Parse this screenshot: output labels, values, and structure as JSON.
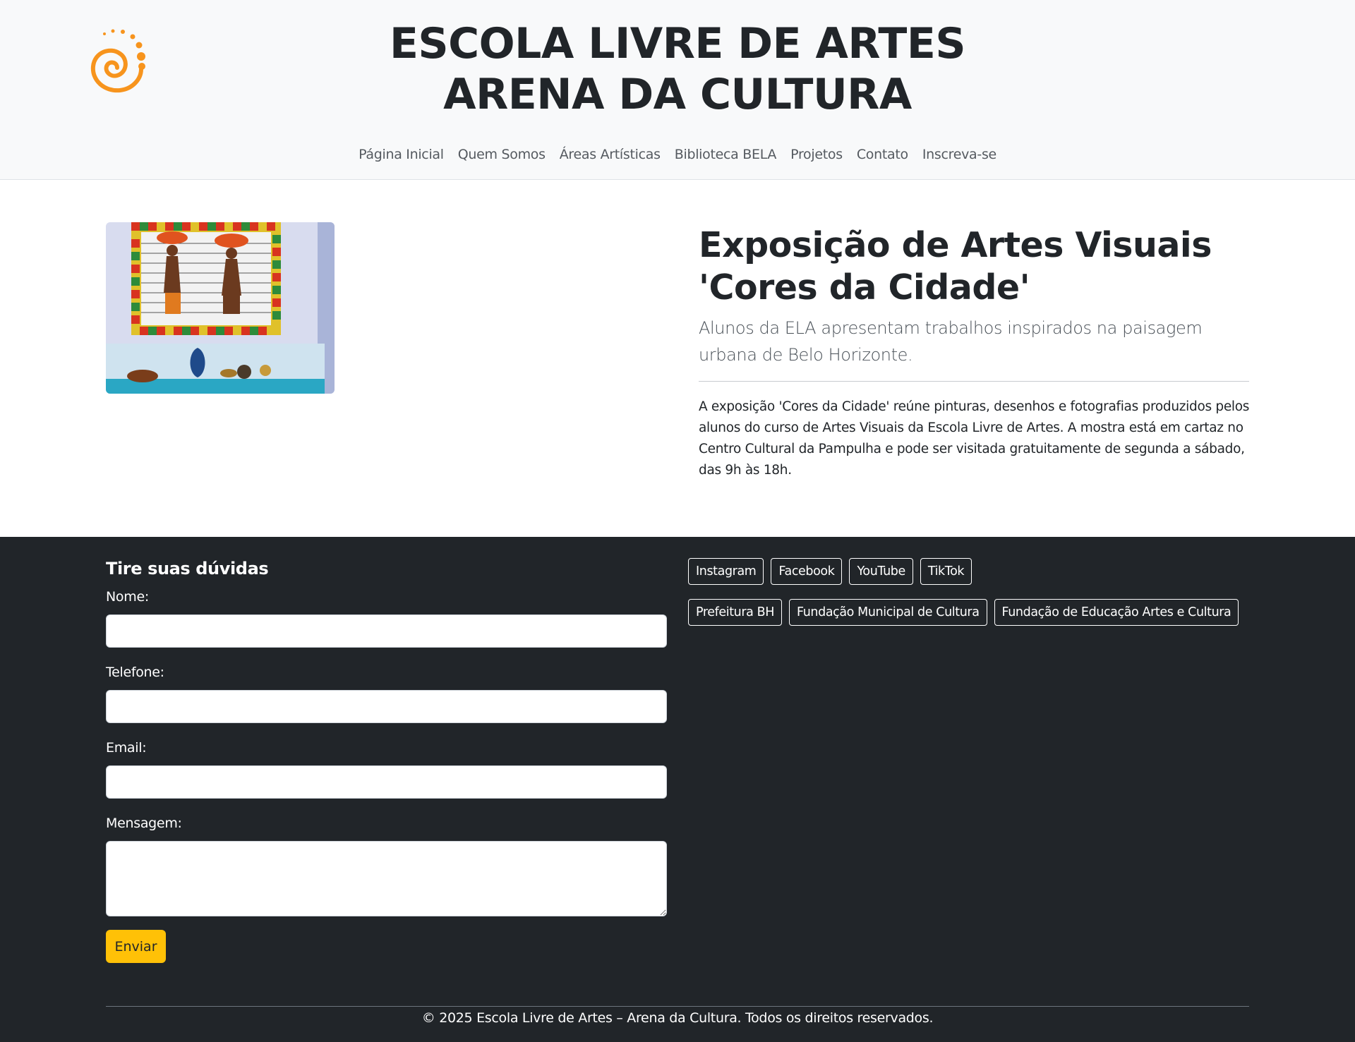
{
  "header": {
    "logo_icon": "spiral-logo-icon",
    "title_line1": "ESCOLA LIVRE DE ARTES",
    "title_line2": "ARENA DA CULTURA",
    "accent_color": "#f7941d",
    "nav": [
      {
        "label": "Página Inicial"
      },
      {
        "label": "Quem Somos"
      },
      {
        "label": "Áreas Artísticas"
      },
      {
        "label": "Biblioteca BELA"
      },
      {
        "label": "Projetos"
      },
      {
        "label": "Contato"
      },
      {
        "label": "Inscreva-se"
      }
    ]
  },
  "article": {
    "image_icon": "artwork-photo",
    "title": "Exposição de Artes Visuais 'Cores da Cidade'",
    "subtitle": "Alunos da ELA apresentam trabalhos inspirados na paisagem urbana de Belo Horizonte.",
    "body": "A exposição 'Cores da Cidade' reúne pinturas, desenhos e fotografias produzidos pelos alunos do curso de Artes Visuais da Escola Livre de Artes. A mostra está em cartaz no Centro Cultural da Pampulha e pode ser visitada gratuitamente de segunda a sábado, das 9h às 18h."
  },
  "footer": {
    "form": {
      "title": "Tire suas dúvidas",
      "name_label": "Nome:",
      "name_value": "",
      "phone_label": "Telefone:",
      "phone_value": "",
      "email_label": "Email:",
      "email_value": "",
      "message_label": "Mensagem:",
      "message_value": "",
      "submit_label": "Enviar",
      "submit_color": "#ffc107"
    },
    "social_links": [
      {
        "label": "Instagram"
      },
      {
        "label": "Facebook"
      },
      {
        "label": "YouTube"
      },
      {
        "label": "TikTok"
      }
    ],
    "partner_links": [
      {
        "label": "Prefeitura BH"
      },
      {
        "label": "Fundação Municipal de Cultura"
      },
      {
        "label": "Fundação de Educação Artes e Cultura"
      }
    ],
    "copyright": "© 2025 Escola Livre de Artes – Arena da Cultura. Todos os direitos reservados.",
    "background_color": "#212529"
  }
}
